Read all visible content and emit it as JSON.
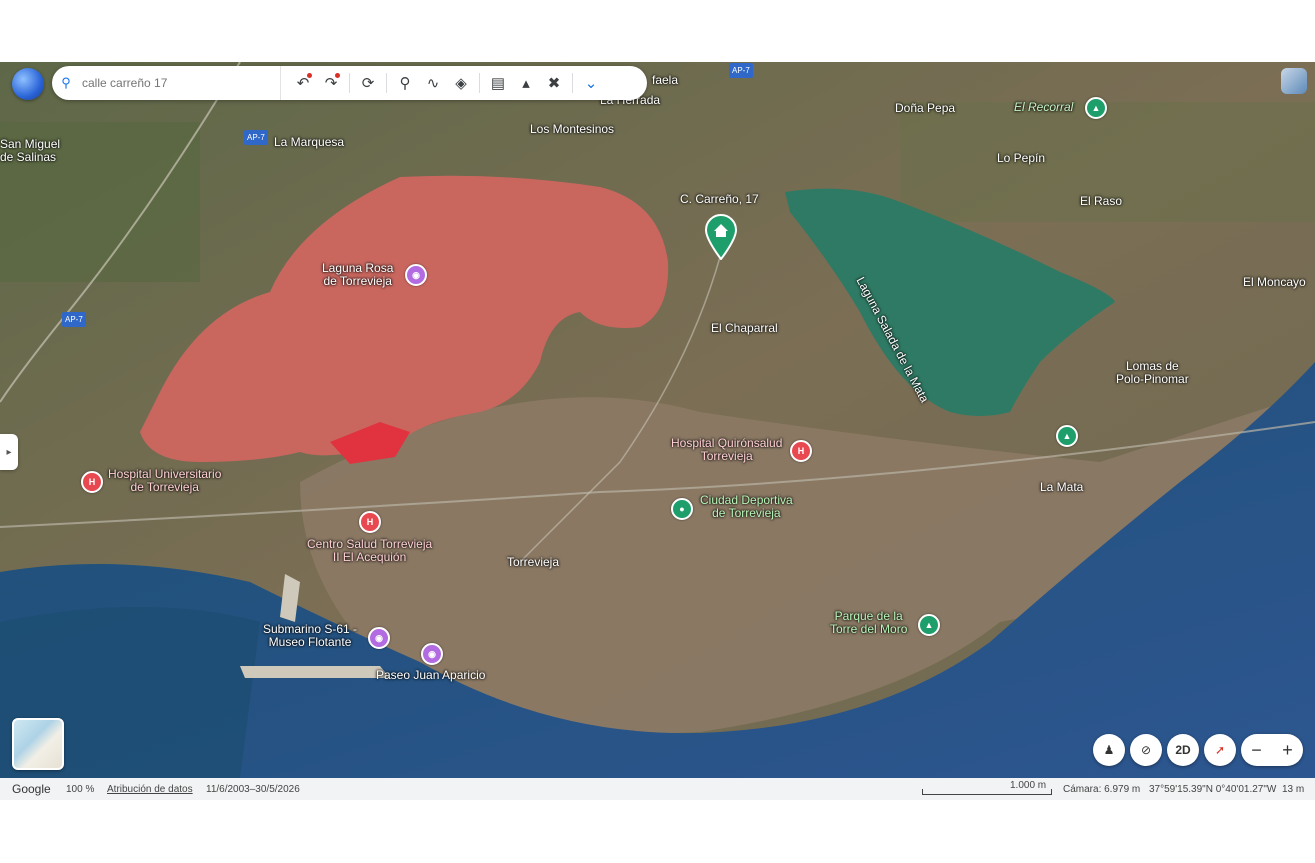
{
  "toolbar": {
    "search_placeholder": "calle carreño 17"
  },
  "map_labels": {
    "san_miguel": "San Miguel\nde Salinas",
    "la_marquesa": "La Marquesa",
    "los_montesinos": "Los Montesinos",
    "la_herrada": "La Herrada",
    "faela": "faela",
    "dona_pepa": "Doña Pepa",
    "el_recorral": "El Recorral",
    "lo_pepin": "Lo Pepín",
    "el_raso": "El Raso",
    "el_moncayo": "El Moncayo",
    "carreno": "C. Carreño, 17",
    "laguna_rosa": "Laguna Rosa\nde Torrevieja",
    "laguna_mata": "Laguna Salada de la Mata",
    "el_chaparral": "El Chaparral",
    "lomas": "Lomas de\nPolo-Pinomar",
    "hospital_quiron": "Hospital Quirónsalud\nTorrevieja",
    "ciudad_deportiva": "Ciudad Deportiva\nde Torrevieja",
    "la_mata": "La Mata",
    "hospital_univ": "Hospital Universitario\nde Torrevieja",
    "centro_salud": "Centro Salud Torrevieja\nII El Acequión",
    "torrevieja": "Torrevieja",
    "parque_torre": "Parque de la\nTorre del Moro",
    "submarino": "Submarino S-61 -\nMuseo Flotante",
    "paseo": "Paseo Juan Aparicio",
    "ap7_a": "AP-7",
    "ap7_b": "AP-7",
    "ap7_c": "AP-7"
  },
  "controls": {
    "view_2d": "2D",
    "zoom_out": "−",
    "zoom_in": "+"
  },
  "status_bar": {
    "brand": "Google",
    "zoom": "100 %",
    "attribution": "Atribución de datos",
    "date_range": "11/6/2003–30/5/2026",
    "scale": "1.000 m",
    "camera": "Cámara: 6.979 m",
    "coords": "37°59'15.39\"N 0°40'01.27\"W",
    "elevation": "13 m"
  },
  "colors": {
    "pink_lake": "#c9675f",
    "green_lake": "#2f7a64",
    "sea": "#1f5f86"
  }
}
